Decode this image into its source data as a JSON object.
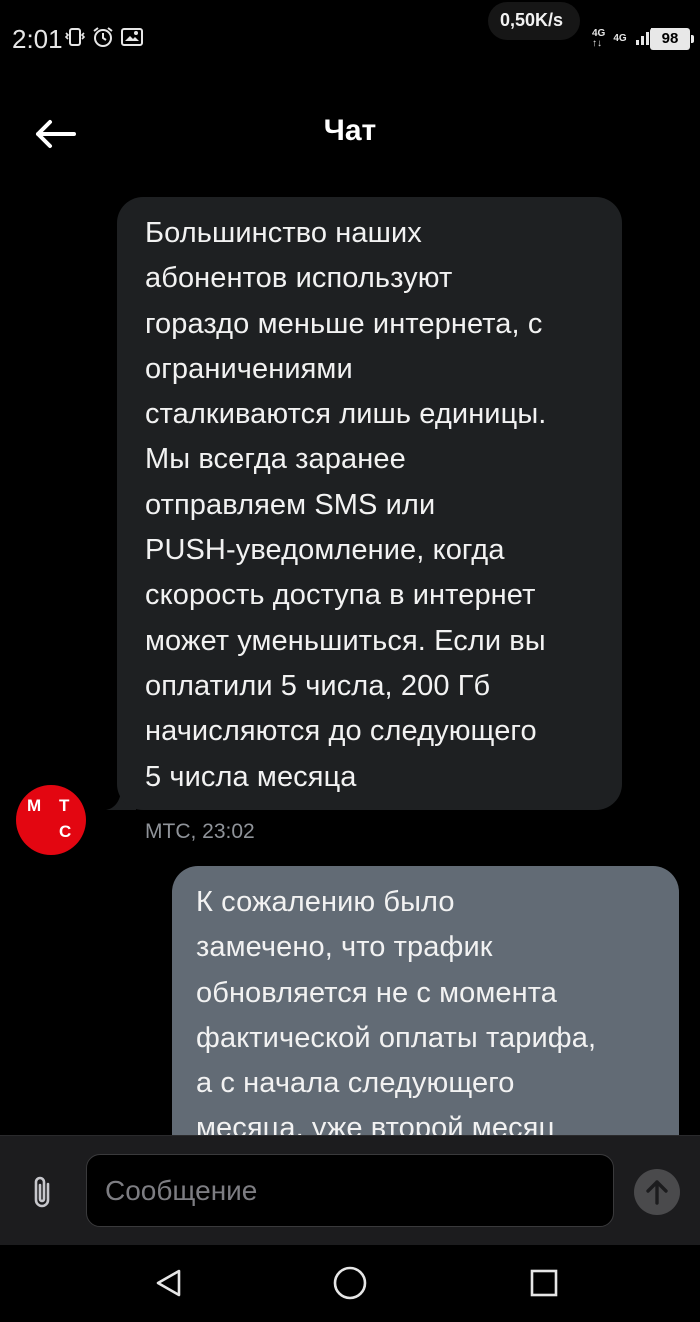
{
  "status_bar": {
    "time": "2:01",
    "net_speed": "0,50K/s",
    "network_1": "4G",
    "network_2": "4G",
    "battery": "98",
    "icons": [
      "vibrate-icon",
      "alarm-icon",
      "notification-icon",
      "signal-icon"
    ]
  },
  "header": {
    "title": "Чат",
    "back_icon": "arrow-left-icon"
  },
  "messages": [
    {
      "direction": "incoming",
      "text": "Большинство наших\nабонентов используют\nгораздо меньше интернета, с\nограничениями\nсталкиваются лишь единицы.\nМы всегда заранее\nотправляем SMS или\nPUSH-уведомление, когда\nскорость доступа в интернет\nможет уменьшиться. Если вы\nоплатили 5 числа, 200 Гб\nначисляются до следующего\n5 числа месяца",
      "meta": "МТС, 23:02",
      "avatar": {
        "letters": [
          "М",
          "Т",
          "С"
        ],
        "color": "#e30611"
      }
    },
    {
      "direction": "outgoing",
      "text": "К сожалению было\nзамечено, что трафик\nобновляется не с момента\nфактической оплаты тарифа,\nа с начала следующего\nмесяца, уже второй месяц"
    }
  ],
  "composer": {
    "placeholder": "Сообщение",
    "value": "",
    "attach_icon": "paperclip-icon",
    "send_icon": "arrow-up-icon"
  },
  "nav": {
    "back_icon": "triangle-back-icon",
    "home_icon": "circle-home-icon",
    "recents_icon": "square-recents-icon"
  },
  "colors": {
    "incoming_bubble": "#1e2022",
    "outgoing_bubble": "#626b75",
    "brand": "#e30611",
    "meta_text": "#8f9399"
  }
}
